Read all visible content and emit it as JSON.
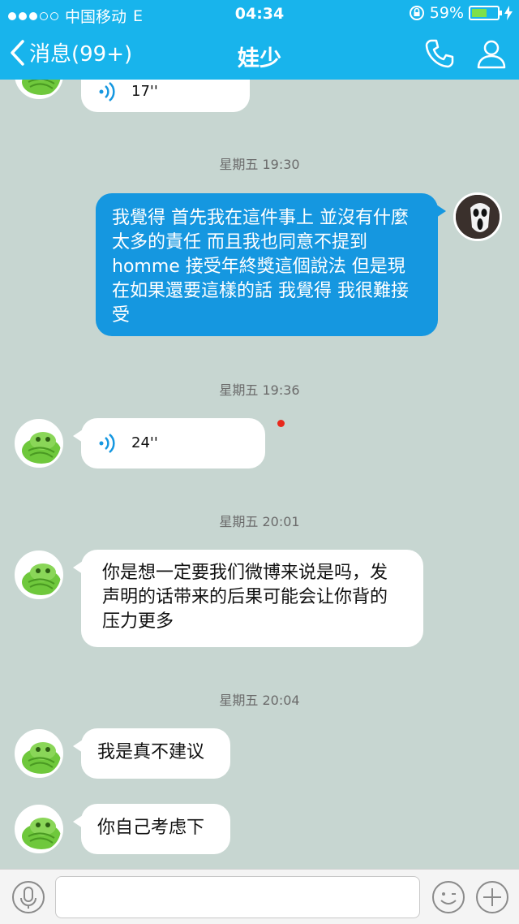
{
  "status_bar": {
    "carrier": "中国移动",
    "network": "E",
    "time": "04:34",
    "battery": "59%",
    "battery_level": 0.59
  },
  "nav": {
    "back_label": "消息(99+)",
    "title": "娃少",
    "icons": [
      "phone-icon",
      "profile-icon"
    ]
  },
  "messages": {
    "m0": {
      "duration": "17''"
    },
    "ts1": "星期五 19:30",
    "m1": {
      "text": "我覺得 首先我在這件事上 並沒有什麼太多的責任 而且我也同意不提到 homme 接受年終獎這個說法 但是現在如果還要這樣的話 我覺得 我很難接受"
    },
    "ts2": "星期五 19:36",
    "m2": {
      "duration": "24''"
    },
    "ts3": "星期五 20:01",
    "m3": {
      "text": "你是想一定要我们微博来说是吗，发声明的话带来的后果可能会让你背的压力更多"
    },
    "ts4": "星期五 20:04",
    "m4": {
      "text": "我是真不建议"
    },
    "m5": {
      "text": "你自己考虑下"
    }
  },
  "input_bar": {
    "placeholder": "",
    "icons": [
      "microphone-icon",
      "emoji-icon",
      "add-icon"
    ]
  },
  "colors": {
    "nav_bg": "#18b4ec",
    "chat_bg": "#c7d6d1",
    "outgoing_bubble": "#1597e0",
    "incoming_bubble": "#ffffff",
    "unread_dot": "#e8291c"
  }
}
